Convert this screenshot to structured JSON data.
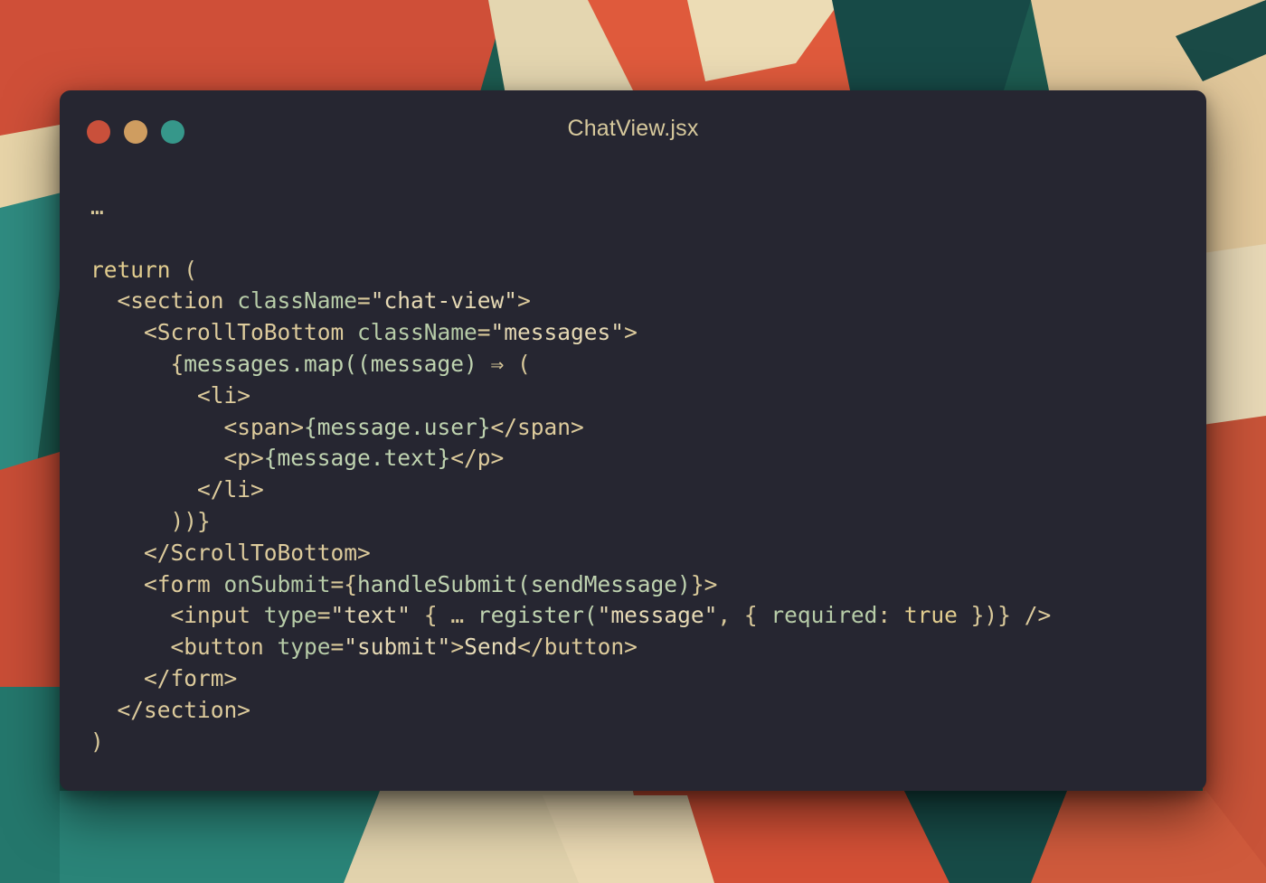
{
  "window": {
    "title": "ChatView.jsx",
    "controls": [
      "close",
      "minimize",
      "zoom"
    ]
  },
  "colors": {
    "close": "#c9503b",
    "minimize": "#cf9d60",
    "zoom": "#36978a",
    "window_bg": "#262631",
    "title_text": "#d6c89c"
  },
  "code": {
    "lines": [
      [
        {
          "t": "…",
          "c": "punc"
        }
      ],
      [],
      [
        {
          "t": "return",
          "c": "kw"
        },
        {
          "t": " (",
          "c": "punc"
        }
      ],
      [
        {
          "t": "  <section ",
          "c": "tag"
        },
        {
          "t": "className",
          "c": "attr"
        },
        {
          "t": "=",
          "c": "punc"
        },
        {
          "t": "\"chat-view\"",
          "c": "str"
        },
        {
          "t": ">",
          "c": "tag"
        }
      ],
      [
        {
          "t": "    <ScrollToBottom ",
          "c": "tag"
        },
        {
          "t": "className",
          "c": "attr"
        },
        {
          "t": "=",
          "c": "punc"
        },
        {
          "t": "\"messages\"",
          "c": "str"
        },
        {
          "t": ">",
          "c": "tag"
        }
      ],
      [
        {
          "t": "      {",
          "c": "punc"
        },
        {
          "t": "messages.map((message) ",
          "c": "expr"
        },
        {
          "t": "⇒",
          "c": "punc"
        },
        {
          "t": " (",
          "c": "punc"
        }
      ],
      [
        {
          "t": "        <li>",
          "c": "tag"
        }
      ],
      [
        {
          "t": "          <span>",
          "c": "tag"
        },
        {
          "t": "{message.user}",
          "c": "expr"
        },
        {
          "t": "</span>",
          "c": "tag"
        }
      ],
      [
        {
          "t": "          <p>",
          "c": "tag"
        },
        {
          "t": "{message.text}",
          "c": "expr"
        },
        {
          "t": "</p>",
          "c": "tag"
        }
      ],
      [
        {
          "t": "        </li>",
          "c": "tag"
        }
      ],
      [
        {
          "t": "      ))}",
          "c": "punc"
        }
      ],
      [
        {
          "t": "    </ScrollToBottom>",
          "c": "tag"
        }
      ],
      [
        {
          "t": "    <form ",
          "c": "tag"
        },
        {
          "t": "onSubmit",
          "c": "attr"
        },
        {
          "t": "={",
          "c": "punc"
        },
        {
          "t": "handleSubmit(sendMessage)",
          "c": "expr"
        },
        {
          "t": "}>",
          "c": "punc"
        }
      ],
      [
        {
          "t": "      <input ",
          "c": "tag"
        },
        {
          "t": "type",
          "c": "attr"
        },
        {
          "t": "=",
          "c": "punc"
        },
        {
          "t": "\"text\"",
          "c": "str"
        },
        {
          "t": " { … ",
          "c": "punc"
        },
        {
          "t": "register(",
          "c": "expr"
        },
        {
          "t": "\"message\"",
          "c": "str"
        },
        {
          "t": ", { ",
          "c": "punc"
        },
        {
          "t": "required",
          "c": "attr"
        },
        {
          "t": ": ",
          "c": "punc"
        },
        {
          "t": "true",
          "c": "kw"
        },
        {
          "t": " })} ",
          "c": "punc"
        },
        {
          "t": "/>",
          "c": "tag"
        }
      ],
      [
        {
          "t": "      <button ",
          "c": "tag"
        },
        {
          "t": "type",
          "c": "attr"
        },
        {
          "t": "=",
          "c": "punc"
        },
        {
          "t": "\"submit\"",
          "c": "str"
        },
        {
          "t": ">",
          "c": "tag"
        },
        {
          "t": "Send",
          "c": "text"
        },
        {
          "t": "</button>",
          "c": "tag"
        }
      ],
      [
        {
          "t": "    </form>",
          "c": "tag"
        }
      ],
      [
        {
          "t": "  </section>",
          "c": "tag"
        }
      ],
      [
        {
          "t": ")",
          "c": "punc"
        }
      ]
    ]
  }
}
